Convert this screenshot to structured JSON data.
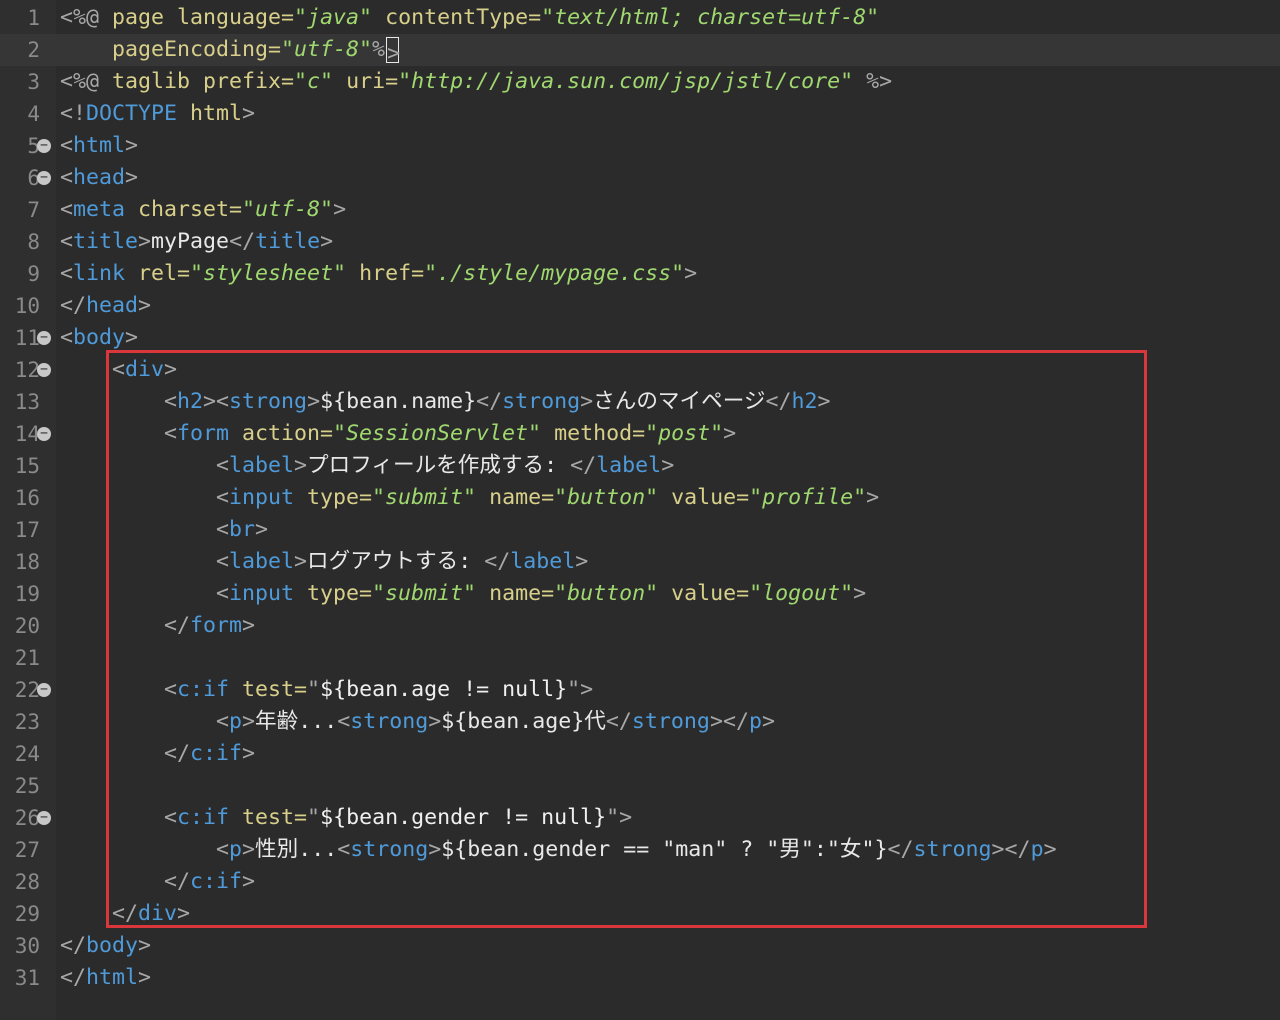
{
  "editor": {
    "language": "JSP",
    "current_line": 2,
    "fold_markers": [
      5,
      6,
      11,
      12,
      14,
      22,
      26
    ],
    "highlight_box": {
      "from_line": 12,
      "to_line": 29,
      "color": "#d9373c"
    }
  },
  "lines": [
    {
      "n": "1",
      "tokens": [
        [
          "p",
          "<%@ "
        ],
        [
          "jsp",
          "page "
        ],
        [
          "attr",
          "language="
        ],
        [
          "val",
          "\"java\""
        ],
        [
          "attr",
          " contentType="
        ],
        [
          "val",
          "\"text/html; charset=utf-8\""
        ]
      ]
    },
    {
      "n": "2",
      "tokens": [
        [
          "p",
          "    "
        ],
        [
          "attr",
          "pageEncoding="
        ],
        [
          "val",
          "\"utf-8\""
        ],
        [
          "p",
          "%"
        ],
        [
          "caret",
          ">"
        ]
      ]
    },
    {
      "n": "3",
      "tokens": [
        [
          "p",
          "<%@ "
        ],
        [
          "jsp",
          "taglib "
        ],
        [
          "attr",
          "prefix="
        ],
        [
          "val",
          "\"c\""
        ],
        [
          "attr",
          " uri="
        ],
        [
          "val",
          "\"http://java.sun.com/jsp/jstl/core\""
        ],
        [
          "p",
          " %>"
        ]
      ]
    },
    {
      "n": "4",
      "tokens": [
        [
          "p",
          "<!"
        ],
        [
          "tag",
          "DOCTYPE "
        ],
        [
          "attr",
          "html"
        ],
        [
          "p",
          ">"
        ]
      ]
    },
    {
      "n": "5",
      "tokens": [
        [
          "p",
          "<"
        ],
        [
          "tag",
          "html"
        ],
        [
          "p",
          ">"
        ]
      ]
    },
    {
      "n": "6",
      "tokens": [
        [
          "p",
          "<"
        ],
        [
          "tag",
          "head"
        ],
        [
          "p",
          ">"
        ]
      ]
    },
    {
      "n": "7",
      "tokens": [
        [
          "p",
          "<"
        ],
        [
          "tag",
          "meta "
        ],
        [
          "attr",
          "charset="
        ],
        [
          "val",
          "\"utf-8\""
        ],
        [
          "p",
          ">"
        ]
      ]
    },
    {
      "n": "8",
      "tokens": [
        [
          "p",
          "<"
        ],
        [
          "tag",
          "title"
        ],
        [
          "p",
          ">"
        ],
        [
          "txt",
          "myPage"
        ],
        [
          "p",
          "</"
        ],
        [
          "tag",
          "title"
        ],
        [
          "p",
          ">"
        ]
      ]
    },
    {
      "n": "9",
      "tokens": [
        [
          "p",
          "<"
        ],
        [
          "tag",
          "link "
        ],
        [
          "attr",
          "rel="
        ],
        [
          "val",
          "\"stylesheet\""
        ],
        [
          "attr",
          " href="
        ],
        [
          "val",
          "\"./style/mypage.css\""
        ],
        [
          "p",
          ">"
        ]
      ]
    },
    {
      "n": "10",
      "tokens": [
        [
          "p",
          "</"
        ],
        [
          "tag",
          "head"
        ],
        [
          "p",
          ">"
        ]
      ]
    },
    {
      "n": "11",
      "tokens": [
        [
          "p",
          "<"
        ],
        [
          "tag",
          "body"
        ],
        [
          "p",
          ">"
        ]
      ]
    },
    {
      "n": "12",
      "tokens": [
        [
          "p",
          "    <"
        ],
        [
          "tag",
          "div"
        ],
        [
          "p",
          ">"
        ]
      ]
    },
    {
      "n": "13",
      "tokens": [
        [
          "p",
          "        <"
        ],
        [
          "tag",
          "h2"
        ],
        [
          "p",
          "><"
        ],
        [
          "tag",
          "strong"
        ],
        [
          "p",
          ">"
        ],
        [
          "txt",
          "${bean.name}"
        ],
        [
          "p",
          "</"
        ],
        [
          "tag",
          "strong"
        ],
        [
          "p",
          ">"
        ],
        [
          "txt",
          "さんのマイページ"
        ],
        [
          "p",
          "</"
        ],
        [
          "tag",
          "h2"
        ],
        [
          "p",
          ">"
        ]
      ]
    },
    {
      "n": "14",
      "tokens": [
        [
          "p",
          "        <"
        ],
        [
          "tag",
          "form "
        ],
        [
          "attr",
          "action="
        ],
        [
          "val",
          "\"SessionServlet\""
        ],
        [
          "attr",
          " method="
        ],
        [
          "val",
          "\"post\""
        ],
        [
          "p",
          ">"
        ]
      ]
    },
    {
      "n": "15",
      "tokens": [
        [
          "p",
          "            <"
        ],
        [
          "tag",
          "label"
        ],
        [
          "p",
          ">"
        ],
        [
          "txt",
          "プロフィールを作成する: "
        ],
        [
          "p",
          "</"
        ],
        [
          "tag",
          "label"
        ],
        [
          "p",
          ">"
        ]
      ]
    },
    {
      "n": "16",
      "tokens": [
        [
          "p",
          "            <"
        ],
        [
          "tag",
          "input "
        ],
        [
          "attr",
          "type="
        ],
        [
          "val",
          "\"submit\""
        ],
        [
          "attr",
          " name="
        ],
        [
          "val",
          "\"button\""
        ],
        [
          "attr",
          " value="
        ],
        [
          "val",
          "\"profile\""
        ],
        [
          "p",
          ">"
        ]
      ]
    },
    {
      "n": "17",
      "tokens": [
        [
          "p",
          "            <"
        ],
        [
          "tag",
          "br"
        ],
        [
          "p",
          ">"
        ]
      ]
    },
    {
      "n": "18",
      "tokens": [
        [
          "p",
          "            <"
        ],
        [
          "tag",
          "label"
        ],
        [
          "p",
          ">"
        ],
        [
          "txt",
          "ログアウトする: "
        ],
        [
          "p",
          "</"
        ],
        [
          "tag",
          "label"
        ],
        [
          "p",
          ">"
        ]
      ]
    },
    {
      "n": "19",
      "tokens": [
        [
          "p",
          "            <"
        ],
        [
          "tag",
          "input "
        ],
        [
          "attr",
          "type="
        ],
        [
          "val",
          "\"submit\""
        ],
        [
          "attr",
          " name="
        ],
        [
          "val",
          "\"button\""
        ],
        [
          "attr",
          " value="
        ],
        [
          "val",
          "\"logout\""
        ],
        [
          "p",
          ">"
        ]
      ]
    },
    {
      "n": "20",
      "tokens": [
        [
          "p",
          "        </"
        ],
        [
          "tag",
          "form"
        ],
        [
          "p",
          ">"
        ]
      ]
    },
    {
      "n": "21",
      "tokens": []
    },
    {
      "n": "22",
      "tokens": [
        [
          "p",
          "        <"
        ],
        [
          "tag",
          "c:if "
        ],
        [
          "attr",
          "test="
        ],
        [
          "p",
          "\""
        ],
        [
          "str",
          "${bean.age != null}"
        ],
        [
          "p",
          "\">"
        ]
      ]
    },
    {
      "n": "23",
      "tokens": [
        [
          "p",
          "            <"
        ],
        [
          "tag",
          "p"
        ],
        [
          "p",
          ">"
        ],
        [
          "txt",
          "年齢..."
        ],
        [
          "p",
          "<"
        ],
        [
          "tag",
          "strong"
        ],
        [
          "p",
          ">"
        ],
        [
          "txt",
          "${bean.age}代"
        ],
        [
          "p",
          "</"
        ],
        [
          "tag",
          "strong"
        ],
        [
          "p",
          "></"
        ],
        [
          "tag",
          "p"
        ],
        [
          "p",
          ">"
        ]
      ]
    },
    {
      "n": "24",
      "tokens": [
        [
          "p",
          "        </"
        ],
        [
          "tag",
          "c:if"
        ],
        [
          "p",
          ">"
        ]
      ]
    },
    {
      "n": "25",
      "tokens": []
    },
    {
      "n": "26",
      "tokens": [
        [
          "p",
          "        <"
        ],
        [
          "tag",
          "c:if "
        ],
        [
          "attr",
          "test="
        ],
        [
          "p",
          "\""
        ],
        [
          "str",
          "${bean.gender != null}"
        ],
        [
          "p",
          "\">"
        ]
      ]
    },
    {
      "n": "27",
      "tokens": [
        [
          "p",
          "            <"
        ],
        [
          "tag",
          "p"
        ],
        [
          "p",
          ">"
        ],
        [
          "txt",
          "性別..."
        ],
        [
          "p",
          "<"
        ],
        [
          "tag",
          "strong"
        ],
        [
          "p",
          ">"
        ],
        [
          "txt",
          "${bean.gender == \"man\" ? \"男\":\"女\"}"
        ],
        [
          "p",
          "</"
        ],
        [
          "tag",
          "strong"
        ],
        [
          "p",
          "></"
        ],
        [
          "tag",
          "p"
        ],
        [
          "p",
          ">"
        ]
      ]
    },
    {
      "n": "28",
      "tokens": [
        [
          "p",
          "        </"
        ],
        [
          "tag",
          "c:if"
        ],
        [
          "p",
          ">"
        ]
      ]
    },
    {
      "n": "29",
      "tokens": [
        [
          "p",
          "    </"
        ],
        [
          "tag",
          "div"
        ],
        [
          "p",
          ">"
        ]
      ]
    },
    {
      "n": "30",
      "tokens": [
        [
          "p",
          "</"
        ],
        [
          "tag",
          "body"
        ],
        [
          "p",
          ">"
        ]
      ]
    },
    {
      "n": "31",
      "tokens": [
        [
          "p",
          "</"
        ],
        [
          "tag",
          "html"
        ],
        [
          "p",
          ">"
        ]
      ]
    }
  ]
}
